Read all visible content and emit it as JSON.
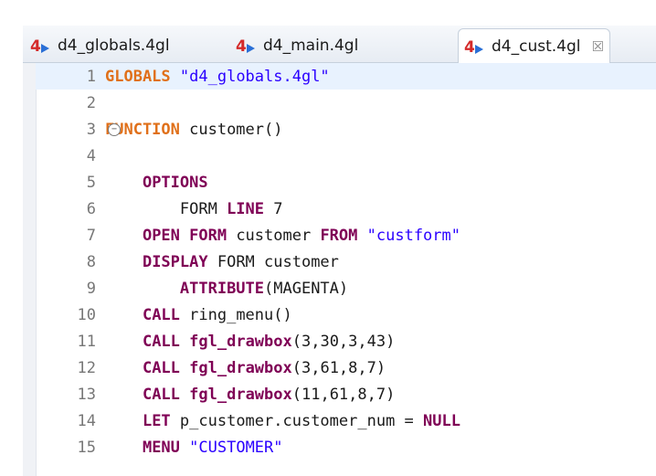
{
  "tabs": [
    {
      "label": "d4_globals.4gl",
      "icon": "4gl-file-icon"
    },
    {
      "label": "d4_main.4gl",
      "icon": "4gl-file-icon"
    },
    {
      "label": "d4_cust.4gl",
      "icon": "4gl-file-icon",
      "active": true,
      "close": "☒"
    }
  ],
  "lines": [
    {
      "n": "1",
      "tokens": [
        {
          "t": "GLOBALS",
          "c": "kw-orange"
        },
        {
          "t": " "
        },
        {
          "t": "\"d4_globals.4gl\"",
          "c": "str"
        }
      ]
    },
    {
      "n": "2",
      "tokens": []
    },
    {
      "n": "3",
      "fold": "−",
      "tokens": [
        {
          "t": "FUNCTION",
          "c": "kw-orange"
        },
        {
          "t": " customer()"
        }
      ]
    },
    {
      "n": "4",
      "tokens": []
    },
    {
      "n": "5",
      "tokens": [
        {
          "t": "    "
        },
        {
          "t": "OPTIONS",
          "c": "kw"
        }
      ]
    },
    {
      "n": "6",
      "tokens": [
        {
          "t": "        FORM "
        },
        {
          "t": "LINE",
          "c": "kw"
        },
        {
          "t": " 7"
        }
      ]
    },
    {
      "n": "7",
      "tokens": [
        {
          "t": "    "
        },
        {
          "t": "OPEN FORM",
          "c": "kw"
        },
        {
          "t": " customer "
        },
        {
          "t": "FROM",
          "c": "kw"
        },
        {
          "t": " "
        },
        {
          "t": "\"custform\"",
          "c": "str"
        }
      ]
    },
    {
      "n": "8",
      "tokens": [
        {
          "t": "    "
        },
        {
          "t": "DISPLAY",
          "c": "kw"
        },
        {
          "t": " FORM customer"
        }
      ]
    },
    {
      "n": "9",
      "tokens": [
        {
          "t": "        "
        },
        {
          "t": "ATTRIBUTE",
          "c": "kw"
        },
        {
          "t": "(MAGENTA)"
        }
      ]
    },
    {
      "n": "10",
      "tokens": [
        {
          "t": "    "
        },
        {
          "t": "CALL",
          "c": "kw"
        },
        {
          "t": " ring_menu()"
        }
      ]
    },
    {
      "n": "11",
      "tokens": [
        {
          "t": "    "
        },
        {
          "t": "CALL",
          "c": "kw"
        },
        {
          "t": " "
        },
        {
          "t": "fgl_drawbox",
          "c": "kw"
        },
        {
          "t": "(3,30,3,43)"
        }
      ]
    },
    {
      "n": "12",
      "tokens": [
        {
          "t": "    "
        },
        {
          "t": "CALL",
          "c": "kw"
        },
        {
          "t": " "
        },
        {
          "t": "fgl_drawbox",
          "c": "kw"
        },
        {
          "t": "(3,61,8,7)"
        }
      ]
    },
    {
      "n": "13",
      "tokens": [
        {
          "t": "    "
        },
        {
          "t": "CALL",
          "c": "kw"
        },
        {
          "t": " "
        },
        {
          "t": "fgl_drawbox",
          "c": "kw"
        },
        {
          "t": "(11,61,8,7)"
        }
      ]
    },
    {
      "n": "14",
      "tokens": [
        {
          "t": "    "
        },
        {
          "t": "LET",
          "c": "kw"
        },
        {
          "t": " p_customer.customer_num = "
        },
        {
          "t": "NULL",
          "c": "kw"
        }
      ]
    },
    {
      "n": "15",
      "tokens": [
        {
          "t": "    "
        },
        {
          "t": "MENU",
          "c": "kw"
        },
        {
          "t": " "
        },
        {
          "t": "\"CUSTOMER\"",
          "c": "str"
        }
      ]
    }
  ],
  "colors": {
    "keyword": "#7f0055",
    "keyword_orange": "#e0701a",
    "string": "#2a00ff",
    "line_number": "#777777",
    "current_line": "#e8f2fe"
  }
}
